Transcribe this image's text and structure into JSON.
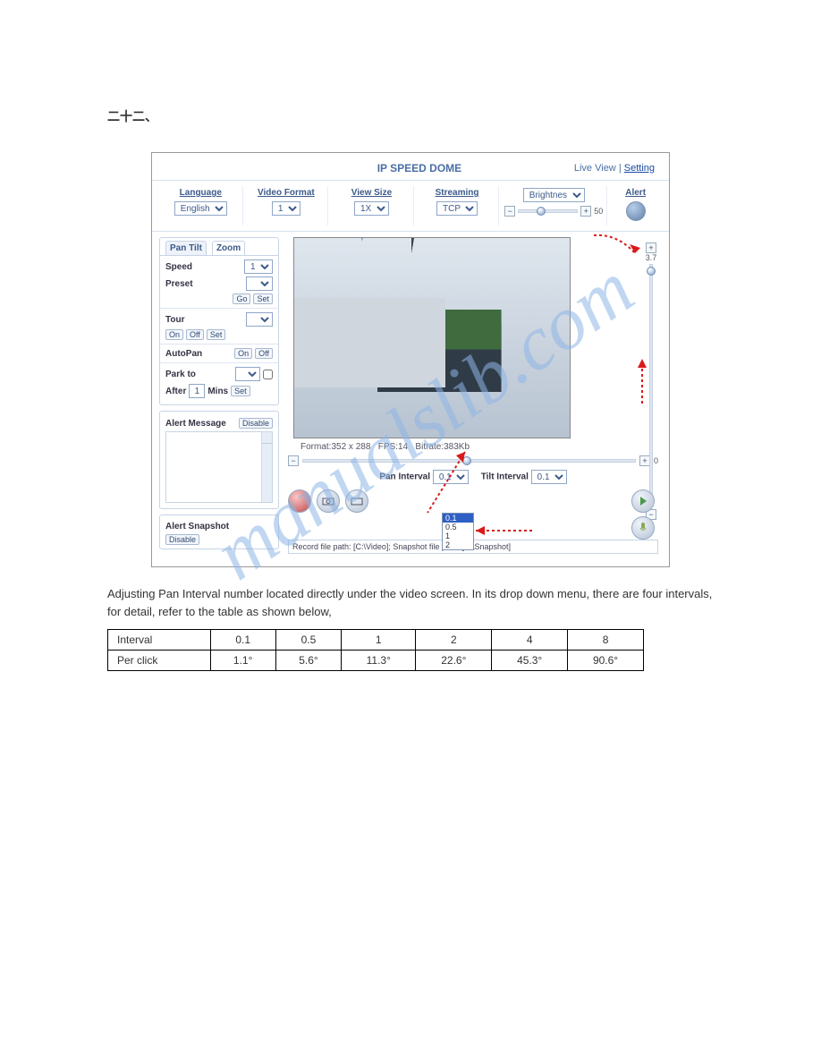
{
  "section_number": "二十二、",
  "watermark": "manualslib.com",
  "screenshot": {
    "title": "IP SPEED DOME",
    "top_links": {
      "liveview": "Live View",
      "sep": "|",
      "setting": "Setting"
    },
    "menu": {
      "language": {
        "label": "Language",
        "value": "English"
      },
      "video_format": {
        "label": "Video Format",
        "value": "1"
      },
      "view_size": {
        "label": "View Size",
        "value": "1X"
      },
      "streaming": {
        "label": "Streaming",
        "value": "TCP"
      },
      "brightness": {
        "value": "Brightnes"
      },
      "brightness_slider": {
        "val": "50"
      },
      "alert": {
        "label": "Alert"
      }
    },
    "ptz": {
      "tab_pantilt": "Pan Tilt",
      "tab_zoom": "Zoom",
      "speed": {
        "label": "Speed",
        "value": "1"
      },
      "preset": {
        "label": "Preset",
        "go": "Go",
        "set": "Set"
      },
      "tour": {
        "label": "Tour",
        "on": "On",
        "off": "Off",
        "set": "Set"
      },
      "autopan": {
        "label": "AutoPan",
        "on": "On",
        "off": "Off"
      },
      "parkto": {
        "label": "Park to"
      },
      "after": {
        "label": "After",
        "value": "1",
        "unit": "Mins",
        "set": "Set"
      }
    },
    "alert_message": {
      "label": "Alert Message",
      "disable": "Disable"
    },
    "alert_snapshot": {
      "label": "Alert Snapshot",
      "disable": "Disable"
    },
    "vslider": {
      "top_val": "3.7"
    },
    "under_video": {
      "format": "Format:352 x 288",
      "fps": "FPS:14",
      "bitrate": "Bitrate:383Kb"
    },
    "hslider_bot": {
      "val": "0"
    },
    "intervals": {
      "pan_label": "Pan Interval",
      "pan_value": "0.1",
      "tilt_label": "Tilt Interval",
      "tilt_value": "0.1",
      "options": [
        "0.1",
        "0.5",
        "1",
        "2"
      ]
    },
    "pathbar": "Record file path: [C:\\Video]; Snapshot file path: [C:\\Snapshot]"
  },
  "paragraph": "Adjusting Pan Interval number located directly under the video screen. In its drop down menu, there are four intervals, for detail, refer to the table as shown below,",
  "table": {
    "h1": "Interval",
    "h2": "Per click",
    "r1": [
      "0.1",
      "0.5",
      "1",
      "2"
    ],
    "r2": [
      "1.1°",
      "5.6°",
      "11.3°",
      "22.6°",
      "45.3°",
      "90.6°"
    ]
  },
  "table_extra": {
    "c5": "4",
    "c6": "8"
  }
}
